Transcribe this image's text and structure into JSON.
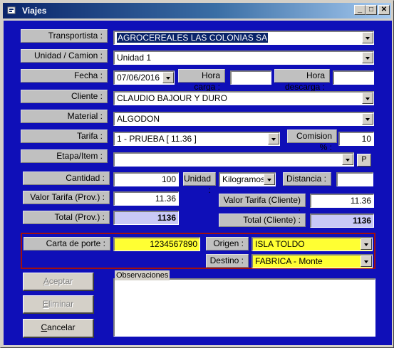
{
  "window": {
    "title": "Viajes",
    "min_label": "_",
    "max_label": "□",
    "close_label": "✕"
  },
  "form": {
    "transportista": {
      "label": "Transportista :",
      "value": "AGROCEREALES LAS COLONIAS SA"
    },
    "unidad_camion": {
      "label": "Unidad / Camion :",
      "value": "Unidad 1"
    },
    "fecha": {
      "label": "Fecha :",
      "value": "07/06/2016"
    },
    "hora_carga": {
      "label": "Hora carga :",
      "value": ""
    },
    "hora_descarga": {
      "label": "Hora descarga :",
      "value": ""
    },
    "cliente": {
      "label": "Cliente :",
      "value": "CLAUDIO BAJOUR Y DURO"
    },
    "material": {
      "label": "Material :",
      "value": "ALGODON"
    },
    "tarifa": {
      "label": "Tarifa :",
      "value": "1 - PRUEBA [ 11.36 ]"
    },
    "comision": {
      "label": "Comision % :",
      "value": "10"
    },
    "etapa_item": {
      "label": "Etapa/Item :",
      "value": "",
      "p_button": "P"
    },
    "cantidad": {
      "label": "Cantidad :",
      "value": "100"
    },
    "unidad": {
      "label": "Unidad :",
      "value": "Kilogramos"
    },
    "distancia": {
      "label": "Distancia :",
      "value": ""
    },
    "valor_tarifa_prov": {
      "label": "Valor Tarifa (Prov.) :",
      "value": "11.36"
    },
    "valor_tarifa_cliente": {
      "label": "Valor Tarifa (Cliente) :",
      "value": "11.36"
    },
    "total_prov": {
      "label": "Total (Prov.) :",
      "value": "1136"
    },
    "total_cliente": {
      "label": "Total (Cliente) :",
      "value": "1136"
    },
    "carta_de_porte": {
      "label": "Carta de porte :",
      "value": "1234567890"
    },
    "origen": {
      "label": "Origen :",
      "value": "ISLA TOLDO"
    },
    "destino": {
      "label": "Destino :",
      "value": "FABRICA - Monte"
    },
    "observaciones": {
      "label": "Observaciones",
      "value": ""
    }
  },
  "buttons": {
    "aceptar_rest": "ceptar",
    "aceptar_key": "A",
    "eliminar_rest": "liminar",
    "eliminar_key": "E",
    "cancelar_rest": "ancelar",
    "cancelar_key": "C"
  },
  "colors": {
    "background": "#0f0fb8",
    "highlight": "#ffff33",
    "total": "#c8c8f6",
    "frame": "#a01010"
  }
}
